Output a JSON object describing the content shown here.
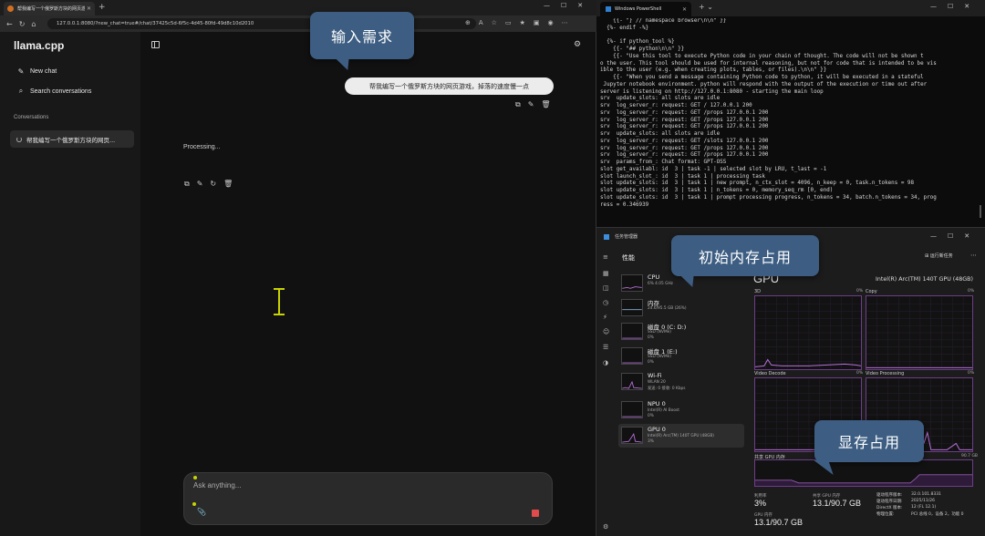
{
  "browser": {
    "tab_title": "帮我编写一个俄罗斯方块的网页游...",
    "url": "127.0.0.1:8080/?new_chat=true#/chat/37425c5d-6f5c-4d45-80fd-49d8c10d2010",
    "app_title": "llama.cpp",
    "new_chat_label": "New chat",
    "search_label": "Search conversations",
    "conversations_heading": "Conversations",
    "conversation_item": "帮我编写一个俄罗斯方块的网页...",
    "user_message": "帮我编写一个俄罗斯方块的网页游戏，掉落的速度慢一点",
    "processing_text": "Processing...",
    "composer_placeholder": "Ask anything..."
  },
  "callouts": {
    "input": "输入需求",
    "memory": "初始内存占用",
    "vram": "显存占用"
  },
  "powershell": {
    "tab_title": "Windows PowerShell",
    "lines": [
      "    {{- \"} // namespace browser\\n\\n\" }}",
      "  {%- endif -%}",
      "",
      "  {%- if python_tool %}",
      "    {{- \"## python\\n\\n\" }}",
      "    {{- \"Use this tool to execute Python code in your chain of thought. The code will not be shown t",
      "o the user. This tool should be used for internal reasoning, but not for code that is intended to be vis",
      "ible to the user (e.g. when creating plots, tables, or files).\\n\\n\" }}",
      "    {{- \"When you send a message containing Python code to python, it will be executed in a stateful",
      " Jupyter notebook environment. python will respond with the output of the execution or time out after",
      "server is listening on http://127.0.0.1:8080 - starting the main loop",
      "srv  update_slots: all slots are idle",
      "srv  log_server_r: request: GET / 127.0.0.1 200",
      "srv  log_server_r: request: GET /props 127.0.0.1 200",
      "srv  log_server_r: request: GET /props 127.0.0.1 200",
      "srv  log_server_r: request: GET /props 127.0.0.1 200",
      "srv  update_slots: all slots are idle",
      "srv  log_server_r: request: GET /slots 127.0.0.1 200",
      "srv  log_server_r: request: GET /props 127.0.0.1 200",
      "srv  log_server_r: request: GET /props 127.0.0.1 200",
      "srv  params_from_: Chat format: GPT-OSS",
      "slot get_availabl: id  3 | task -1 | selected slot by LRU, t_last = -1",
      "slot launch_slot_: id  3 | task 1 | processing task",
      "slot update_slots: id  3 | task 1 | new prompt, n_ctx_slot = 4096, n_keep = 0, task.n_tokens = 98",
      "slot update_slots: id  3 | task 1 | n_tokens = 0, memory_seq_rm [0, end)",
      "slot update_slots: id  3 | task 1 | prompt processing progress, n_tokens = 34, batch.n_tokens = 34, prog",
      "ress = 0.346939"
    ]
  },
  "taskmgr": {
    "title": "任务管理器",
    "section": "性能",
    "run_task": "运行新任务",
    "items": [
      {
        "name": "CPU",
        "sub1": "6%  4.05 GHz",
        "sub2": ""
      },
      {
        "name": "内存",
        "sub1": "24.6/95.5 GB (26%)",
        "sub2": ""
      },
      {
        "name": "磁盘 0 (C: D:)",
        "sub1": "SSD (NVMe)",
        "sub2": "0%"
      },
      {
        "name": "磁盘 1 (E:)",
        "sub1": "SSD (NVMe)",
        "sub2": "0%"
      },
      {
        "name": "Wi-Fi",
        "sub1": "WLAN 20",
        "sub2": "发送: 0 接收: 0 Kbps"
      },
      {
        "name": "NPU 0",
        "sub1": "Intel(R) AI Boost",
        "sub2": "0%"
      },
      {
        "name": "GPU 0",
        "sub1": "Intel(R) Arc(TM) 140T GPU (48GB)",
        "sub2": "3%"
      }
    ],
    "gpu_title": "GPU",
    "gpu_model": "Intel(R) Arc(TM) 140T GPU (48GB)",
    "graphs": [
      {
        "label": "3D",
        "pct": "0%"
      },
      {
        "label": "Copy",
        "pct": "0%"
      },
      {
        "label": "Video Decode",
        "pct": "0%"
      },
      {
        "label": "Video Processing",
        "pct": "0%"
      }
    ],
    "shared_label": "共享 GPU 内存",
    "shared_max": "90.7 GB",
    "util_label": "利用率",
    "util_value": "3%",
    "shared_mem_label": "共享 GPU 内存",
    "shared_mem_value": "13.1/90.7 GB",
    "gpu_mem_label": "GPU 内存",
    "gpu_mem_value": "13.1/90.7 GB",
    "driver_rows": [
      {
        "k": "驱动程序版本:",
        "v": "32.0.101.8331"
      },
      {
        "k": "驱动程序日期:",
        "v": "2025/11/26"
      },
      {
        "k": "DirectX 版本:",
        "v": "12 (FL 12.1)"
      },
      {
        "k": "物理位置:",
        "v": "PCI 总线 0，设备 2，功能 0"
      }
    ]
  }
}
